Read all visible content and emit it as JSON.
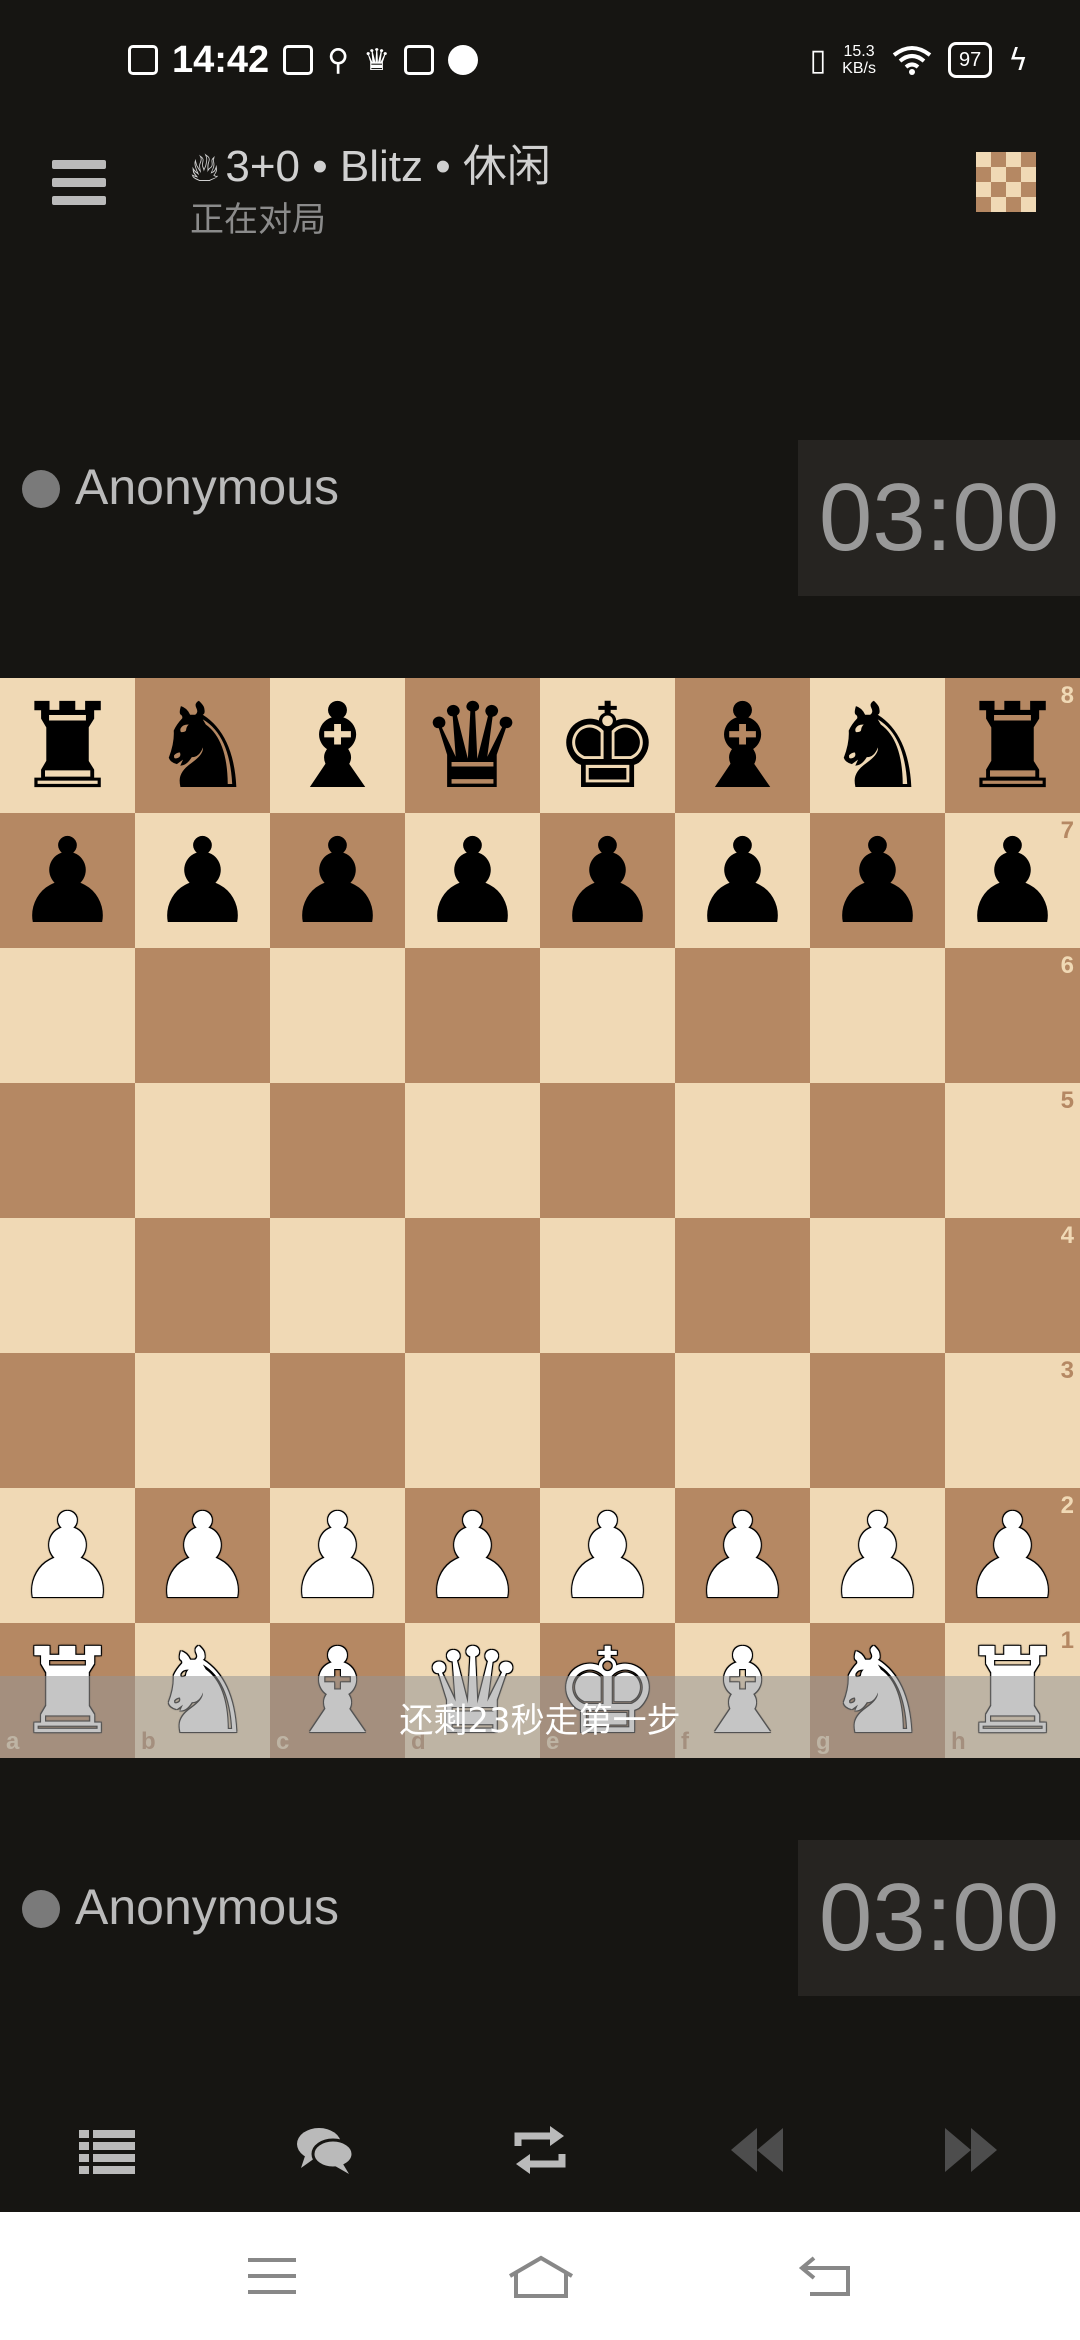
{
  "status_bar": {
    "time": "14:42",
    "net_speed_value": "15.3",
    "net_speed_unit": "KB/s",
    "battery": "97",
    "icons": [
      "sim-icon",
      "bluetooth-audio-icon",
      "usb-icon",
      "crown-icon",
      "play-icon",
      "qq-icon",
      "vibrate-icon",
      "wifi-icon",
      "charging-icon"
    ]
  },
  "header": {
    "title": "3+0 • Blitz • 休闲",
    "subtitle": "正在对局",
    "icons": [
      "menu-icon",
      "fire-icon",
      "board-icon"
    ]
  },
  "opponent": {
    "name": "Anonymous",
    "clock": "03:00"
  },
  "player": {
    "name": "Anonymous",
    "clock": "03:00"
  },
  "board": {
    "light_color": "#f0d9b5",
    "dark_color": "#b58863",
    "position": [
      [
        "r",
        "n",
        "b",
        "q",
        "k",
        "b",
        "n",
        "r"
      ],
      [
        "p",
        "p",
        "p",
        "p",
        "p",
        "p",
        "p",
        "p"
      ],
      [
        "",
        "",
        "",
        "",
        "",
        "",
        "",
        ""
      ],
      [
        "",
        "",
        "",
        "",
        "",
        "",
        "",
        ""
      ],
      [
        "",
        "",
        "",
        "",
        "",
        "",
        "",
        ""
      ],
      [
        "",
        "",
        "",
        "",
        "",
        "",
        "",
        ""
      ],
      [
        "P",
        "P",
        "P",
        "P",
        "P",
        "P",
        "P",
        "P"
      ],
      [
        "R",
        "N",
        "B",
        "Q",
        "K",
        "B",
        "N",
        "R"
      ]
    ],
    "ranks": [
      "8",
      "7",
      "6",
      "5",
      "4",
      "3",
      "2",
      "1"
    ],
    "files": [
      "a",
      "b",
      "c",
      "d",
      "e",
      "f",
      "g",
      "h"
    ]
  },
  "toast": "还剩23秒走第一步",
  "controls": [
    "moves-list-icon",
    "chat-icon",
    "flip-board-icon",
    "rewind-icon",
    "fast-forward-icon"
  ],
  "nav": [
    "recent-apps-icon",
    "home-icon",
    "back-icon"
  ]
}
